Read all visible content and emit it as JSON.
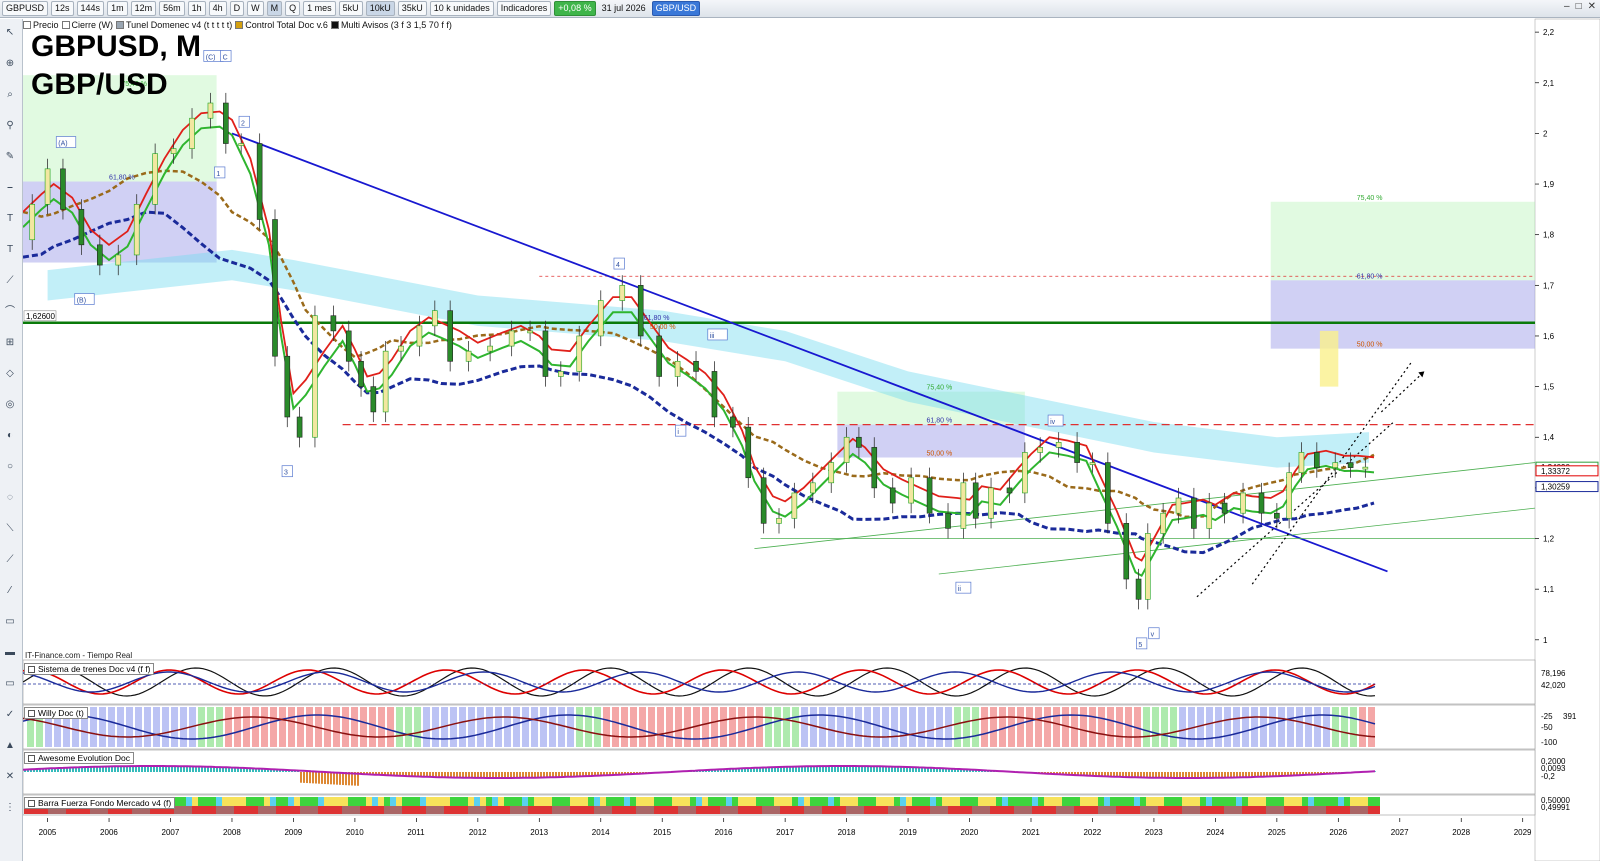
{
  "toolbar": {
    "symbol": "GBPUSD",
    "timeframes": [
      "12s",
      "144s",
      "1m",
      "12m",
      "56m",
      "1h",
      "4h",
      "D",
      "W",
      "M",
      "Q"
    ],
    "selected_timeframe": "M",
    "period": "1 mes",
    "units": [
      "5kU",
      "10kU",
      "35kU"
    ],
    "selected_unit": "10kU",
    "units_select": "10 k unidades",
    "indicators_label": "Indicadores",
    "change": "+0,08 %",
    "date": "31 jul 2026",
    "pair_tag": "GBP/USD"
  },
  "indicator_bar": {
    "items": [
      "Precio",
      "Cierre (W)",
      "Tunel Domenec v4 (t t t t t)",
      "Control Total Doc v.6",
      "Multi Avisos (3 f 3 1,5 70 f f)"
    ]
  },
  "title": "GBPUSD, M",
  "subtitle": "GBP/USD",
  "source": "IT-Finance.com - Tiempo Real",
  "panels": [
    {
      "name": "Sistema de trenes Doc v4 (f f)",
      "values": [
        "78,196",
        "42,020"
      ]
    },
    {
      "name": "Willy Doc (t)",
      "values": [
        "-25",
        "-50",
        "-100",
        "391"
      ]
    },
    {
      "name": "Awesome Evolution Doc",
      "values": [
        "0,2000",
        "0,0093",
        "-0,2"
      ]
    },
    {
      "name": "Barra Fuerza Fondo Mercado v4 (f)",
      "values": [
        "0,50000",
        "0,49991"
      ]
    }
  ],
  "chart_data": {
    "type": "candlestick",
    "title": "GBPUSD, M",
    "subtitle": "GBP/USD",
    "x_ticks": [
      "2005",
      "2006",
      "2007",
      "2008",
      "2009",
      "2010",
      "2011",
      "2012",
      "2013",
      "2014",
      "2015",
      "2016",
      "2017",
      "2018",
      "2019",
      "2020",
      "2021",
      "2022",
      "2023",
      "2024",
      "2025",
      "2026",
      "2027",
      "2028",
      "2029"
    ],
    "xlim": [
      2004.6,
      2029.2
    ],
    "y_ticks": [
      "2,2",
      "2,1",
      "2",
      "1,9",
      "1,8",
      "1,7",
      "1,6",
      "1,5",
      "1,4",
      "1,3",
      "1,2",
      "1,1",
      "1"
    ],
    "ylim": [
      0.97,
      2.22
    ],
    "price_tags": [
      {
        "label": "1,34090",
        "value": 1.3409,
        "color": "#2e9e3a"
      },
      {
        "label": "1,33372",
        "value": 1.3337,
        "color": "#e00000"
      },
      {
        "label": "1,30259",
        "value": 1.3026,
        "color": "#1a2a9a"
      }
    ],
    "level_label": {
      "label": "1,62600",
      "value": 1.626
    },
    "close_series": [
      [
        2004.6,
        1.79
      ],
      [
        2004.9,
        1.86
      ],
      [
        2005.1,
        1.93
      ],
      [
        2005.4,
        1.85
      ],
      [
        2005.7,
        1.78
      ],
      [
        2006.0,
        1.74
      ],
      [
        2006.3,
        1.76
      ],
      [
        2006.6,
        1.86
      ],
      [
        2006.9,
        1.96
      ],
      [
        2007.2,
        1.97
      ],
      [
        2007.5,
        2.03
      ],
      [
        2007.8,
        2.06
      ],
      [
        2008.0,
        1.98
      ],
      [
        2008.3,
        1.98
      ],
      [
        2008.6,
        1.83
      ],
      [
        2008.8,
        1.56
      ],
      [
        2009.0,
        1.44
      ],
      [
        2009.2,
        1.4
      ],
      [
        2009.5,
        1.64
      ],
      [
        2009.8,
        1.61
      ],
      [
        2010.0,
        1.55
      ],
      [
        2010.2,
        1.5
      ],
      [
        2010.4,
        1.45
      ],
      [
        2010.6,
        1.57
      ],
      [
        2010.9,
        1.58
      ],
      [
        2011.2,
        1.62
      ],
      [
        2011.4,
        1.65
      ],
      [
        2011.7,
        1.55
      ],
      [
        2012.0,
        1.57
      ],
      [
        2012.4,
        1.58
      ],
      [
        2012.7,
        1.61
      ],
      [
        2013.0,
        1.61
      ],
      [
        2013.2,
        1.52
      ],
      [
        2013.5,
        1.53
      ],
      [
        2013.8,
        1.6
      ],
      [
        2014.2,
        1.67
      ],
      [
        2014.5,
        1.7
      ],
      [
        2014.8,
        1.6
      ],
      [
        2015.1,
        1.52
      ],
      [
        2015.4,
        1.55
      ],
      [
        2015.7,
        1.53
      ],
      [
        2016.0,
        1.44
      ],
      [
        2016.3,
        1.42
      ],
      [
        2016.5,
        1.32
      ],
      [
        2016.8,
        1.23
      ],
      [
        2017.0,
        1.24
      ],
      [
        2017.3,
        1.29
      ],
      [
        2017.6,
        1.31
      ],
      [
        2017.9,
        1.35
      ],
      [
        2018.1,
        1.4
      ],
      [
        2018.3,
        1.38
      ],
      [
        2018.6,
        1.3
      ],
      [
        2018.9,
        1.27
      ],
      [
        2019.2,
        1.32
      ],
      [
        2019.5,
        1.25
      ],
      [
        2019.8,
        1.22
      ],
      [
        2020.0,
        1.31
      ],
      [
        2020.2,
        1.24
      ],
      [
        2020.5,
        1.3
      ],
      [
        2020.8,
        1.29
      ],
      [
        2021.0,
        1.37
      ],
      [
        2021.3,
        1.38
      ],
      [
        2021.6,
        1.39
      ],
      [
        2021.9,
        1.35
      ],
      [
        2022.1,
        1.35
      ],
      [
        2022.4,
        1.23
      ],
      [
        2022.7,
        1.12
      ],
      [
        2022.8,
        1.08
      ],
      [
        2023.0,
        1.21
      ],
      [
        2023.3,
        1.25
      ],
      [
        2023.5,
        1.28
      ],
      [
        2023.8,
        1.22
      ],
      [
        2024.0,
        1.27
      ],
      [
        2024.3,
        1.25
      ],
      [
        2024.6,
        1.29
      ],
      [
        2024.9,
        1.25
      ],
      [
        2025.1,
        1.24
      ],
      [
        2025.3,
        1.33
      ],
      [
        2025.5,
        1.37
      ],
      [
        2025.8,
        1.34
      ],
      [
        2026.1,
        1.35
      ],
      [
        2026.3,
        1.34
      ],
      [
        2026.58,
        1.341
      ]
    ],
    "fib_labels": [
      "75,40 %",
      "61,80 %",
      "61,80 %",
      "50,00 %",
      "75,40 %",
      "61,80 %",
      "50,00 %",
      "75,40 %",
      "61,80 %",
      "50,00 %"
    ],
    "wave_labels": [
      "(A)",
      "(B)",
      "(C)",
      "C",
      "1",
      "2",
      "3",
      "4",
      "5",
      "i",
      "ii",
      "iii",
      "iv",
      "v"
    ]
  }
}
